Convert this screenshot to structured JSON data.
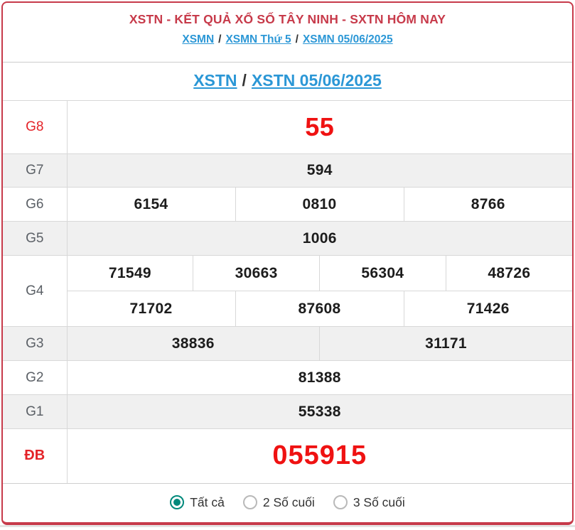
{
  "header": {
    "title": "XSTN - KẾT QUẢ XỔ SỐ TÂY NINH - SXTN HÔM NAY",
    "separator": "/",
    "breadcrumb": [
      {
        "label": "XSMN"
      },
      {
        "label": "XSMN Thứ 5"
      },
      {
        "label": "XSMN 05/06/2025"
      }
    ]
  },
  "subtitle": {
    "separator": "/",
    "links": [
      {
        "label": "XSTN"
      },
      {
        "label": "XSTN 05/06/2025"
      }
    ]
  },
  "results": {
    "g8": {
      "label": "G8",
      "values": [
        "55"
      ]
    },
    "g7": {
      "label": "G7",
      "values": [
        "594"
      ]
    },
    "g6": {
      "label": "G6",
      "values": [
        "6154",
        "0810",
        "8766"
      ]
    },
    "g5": {
      "label": "G5",
      "values": [
        "1006"
      ]
    },
    "g4": {
      "label": "G4",
      "row1": [
        "71549",
        "30663",
        "56304",
        "48726"
      ],
      "row2": [
        "71702",
        "87608",
        "71426"
      ]
    },
    "g3": {
      "label": "G3",
      "values": [
        "38836",
        "31171"
      ]
    },
    "g2": {
      "label": "G2",
      "values": [
        "81388"
      ]
    },
    "g1": {
      "label": "G1",
      "values": [
        "55338"
      ]
    },
    "db": {
      "label": "ĐB",
      "values": [
        "055915"
      ]
    }
  },
  "filter": {
    "options": [
      {
        "label": "Tất cả",
        "selected": true
      },
      {
        "label": "2 Số cuối",
        "selected": false
      },
      {
        "label": "3 Số cuối",
        "selected": false
      }
    ]
  },
  "colors": {
    "accent_crimson": "#c73a4a",
    "bright_red": "#ef1212",
    "link_blue": "#2b97d6",
    "radio_teal": "#00897b",
    "row_gray": "#f0f0f0"
  }
}
